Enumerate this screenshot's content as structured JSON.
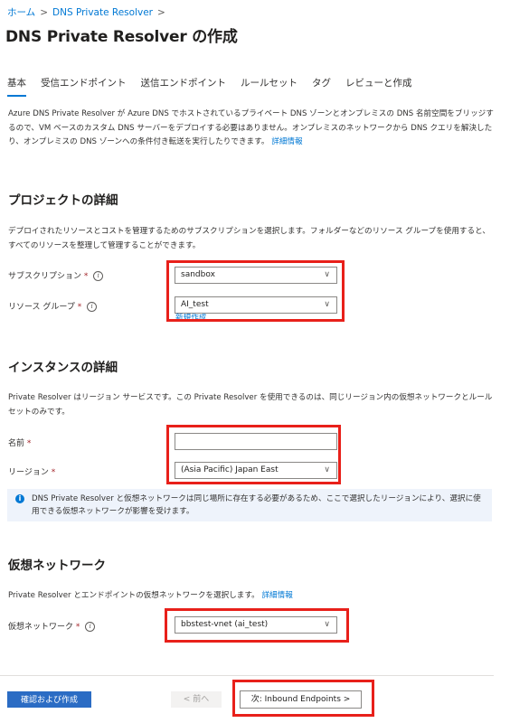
{
  "breadcrumb": {
    "home": "ホーム",
    "current": "DNS Private Resolver",
    "sep": ">"
  },
  "page": {
    "title": "DNS Private Resolver の作成",
    "more": "..."
  },
  "tabs": [
    {
      "label": "基本"
    },
    {
      "label": "受信エンドポイント"
    },
    {
      "label": "送信エンドポイント"
    },
    {
      "label": "ルールセット"
    },
    {
      "label": "タグ"
    },
    {
      "label": "レビューと作成"
    }
  ],
  "intro": {
    "text": "Azure DNS Private Resolver が Azure DNS でホストされているプライベート DNS ゾーンとオンプレミスの DNS 名前空間をブリッジするので、VM ベースのカスタム DNS サーバーをデプロイする必要はありません。オンプレミスのネットワークから DNS クエリを解決したり、オンプレミスの DNS ゾーンへの条件付き転送を実行したりできます。",
    "link": "詳細情報"
  },
  "project": {
    "title": "プロジェクトの詳細",
    "description": "デプロイされたリソースとコストを管理するためのサブスクリプションを選択します。フォルダーなどのリソース グループを使用すると、すべてのリソースを整理して管理することができます。",
    "subscription_label": "サブスクリプション",
    "subscription_value": "sandbox",
    "rg_label": "リソース グループ",
    "rg_value": "AI_test",
    "create_new": "新規作成"
  },
  "instance": {
    "title": "インスタンスの詳細",
    "description": "Private Resolver はリージョン サービスです。この Private Resolver を使用できるのは、同じリージョン内の仮想ネットワークとルールセットのみです。",
    "name_label": "名前",
    "name_value": "",
    "region_label": "リージョン",
    "region_value": "(Asia Pacific) Japan East",
    "info_text": "DNS Private Resolver と仮想ネットワークは同じ場所に存在する必要があるため、ここで選択したリージョンにより、選択に使用できる仮想ネットワークが影響を受けます。"
  },
  "vnet": {
    "title": "仮想ネットワーク",
    "description": "Private Resolver とエンドポイントの仮想ネットワークを選択します。",
    "link": "詳細情報",
    "label": "仮想ネットワーク",
    "value": "bbstest-vnet (ai_test)"
  },
  "common": {
    "required_mark": "*",
    "info_glyph": "i",
    "chevron": "∨"
  },
  "footer": {
    "review_create": "確認および作成",
    "previous": "< 前へ",
    "next": "次: Inbound Endpoints >"
  },
  "colors": {
    "accent": "#0078d4",
    "highlight": "#e8201a",
    "primary_button": "#2b6cc4"
  }
}
